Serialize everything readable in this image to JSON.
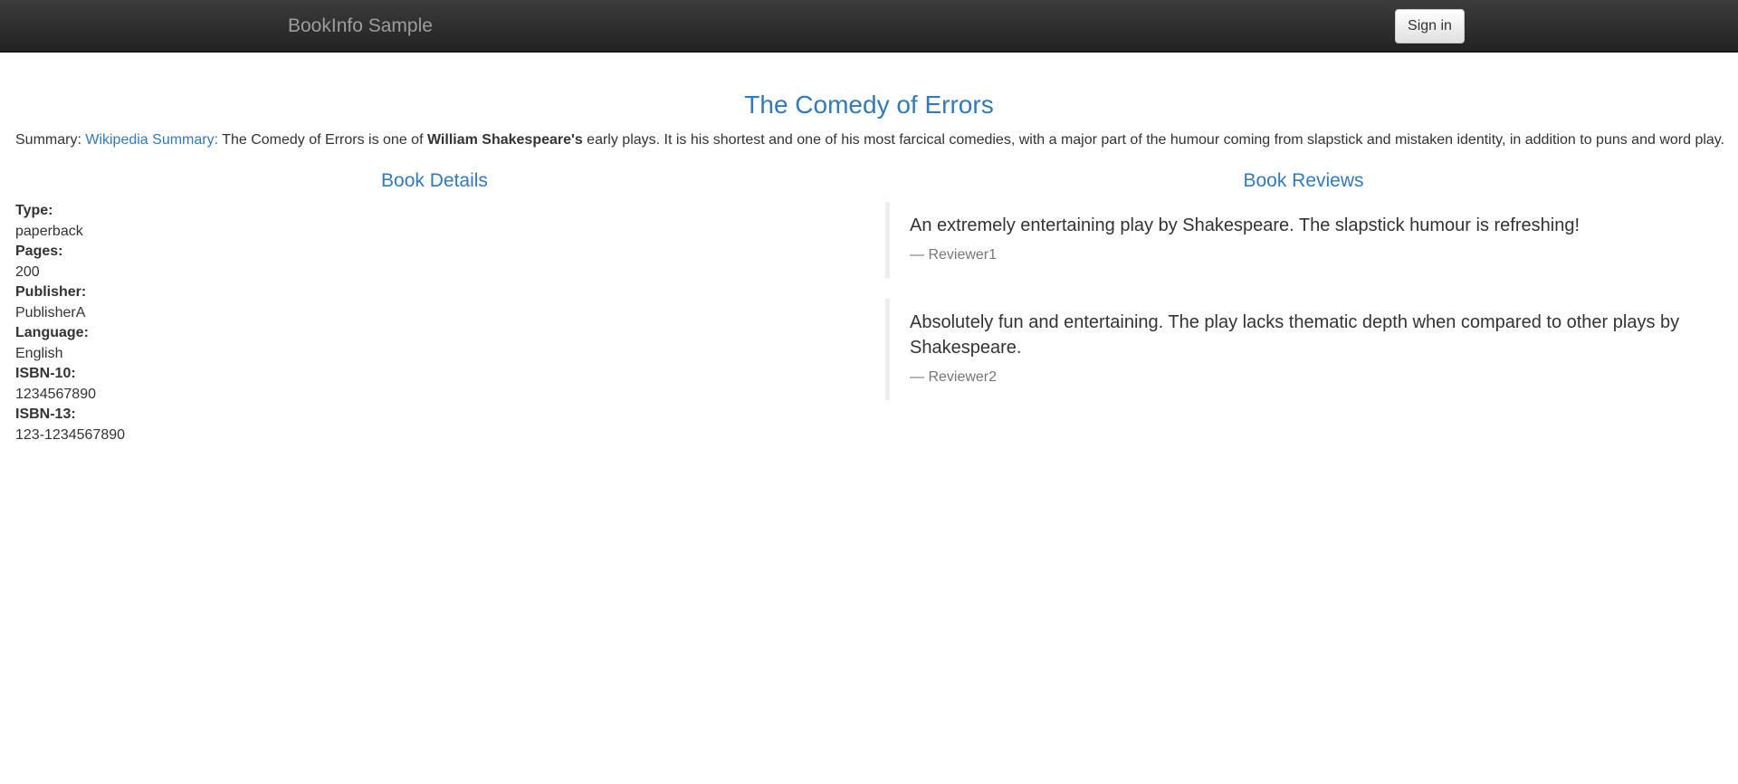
{
  "navbar": {
    "brand": "BookInfo Sample",
    "signin_label": "Sign in"
  },
  "title": "The Comedy of Errors",
  "summary": {
    "prefix": "Summary: ",
    "link_text": "Wikipedia Summary:",
    "text_before_bold": " The Comedy of Errors is one of ",
    "bold_text": "William Shakespeare's",
    "text_after_bold": " early plays. It is his shortest and one of his most farcical comedies, with a major part of the humour coming from slapstick and mistaken identity, in addition to puns and word play."
  },
  "details": {
    "heading": "Book Details",
    "type_label": "Type:",
    "type_value": "paperback",
    "pages_label": "Pages:",
    "pages_value": "200",
    "publisher_label": "Publisher:",
    "publisher_value": "PublisherA",
    "language_label": "Language:",
    "language_value": "English",
    "isbn10_label": "ISBN-10:",
    "isbn10_value": "1234567890",
    "isbn13_label": "ISBN-13:",
    "isbn13_value": "123-1234567890"
  },
  "reviews": {
    "heading": "Book Reviews",
    "items": [
      {
        "text": "An extremely entertaining play by Shakespeare. The slapstick humour is refreshing!",
        "author": "— Reviewer1"
      },
      {
        "text": "Absolutely fun and entertaining. The play lacks thematic depth when compared to other plays by Shakespeare.",
        "author": "— Reviewer2"
      }
    ]
  },
  "colors": {
    "accent": "#337ab7",
    "navbar": "#222222",
    "muted": "#777777"
  }
}
